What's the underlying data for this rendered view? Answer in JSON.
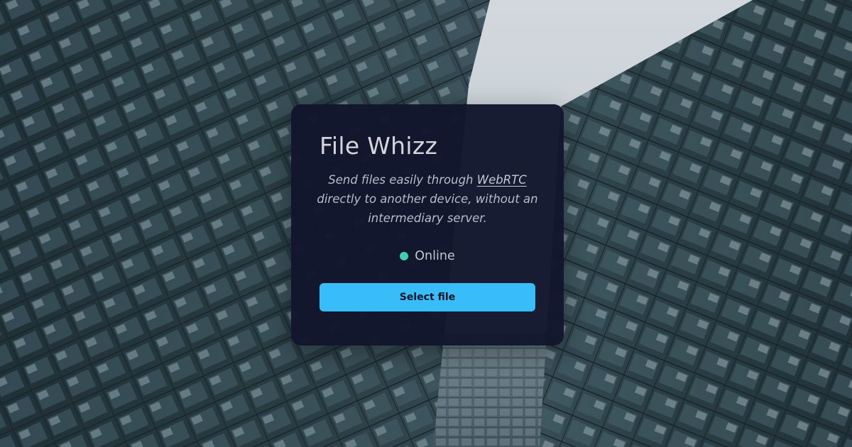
{
  "app": {
    "title": "File Whizz",
    "description_before": "Send files easily through ",
    "description_link": "WebRTC",
    "description_after": " directly to another device, without an intermediary server.",
    "status_label": "Online",
    "button_label": "Select file"
  },
  "colors": {
    "card_background": "#12162c",
    "button": "#38bdf8",
    "status_dot": "#3fd0b0"
  },
  "icons": {
    "status": "status-dot-icon"
  }
}
